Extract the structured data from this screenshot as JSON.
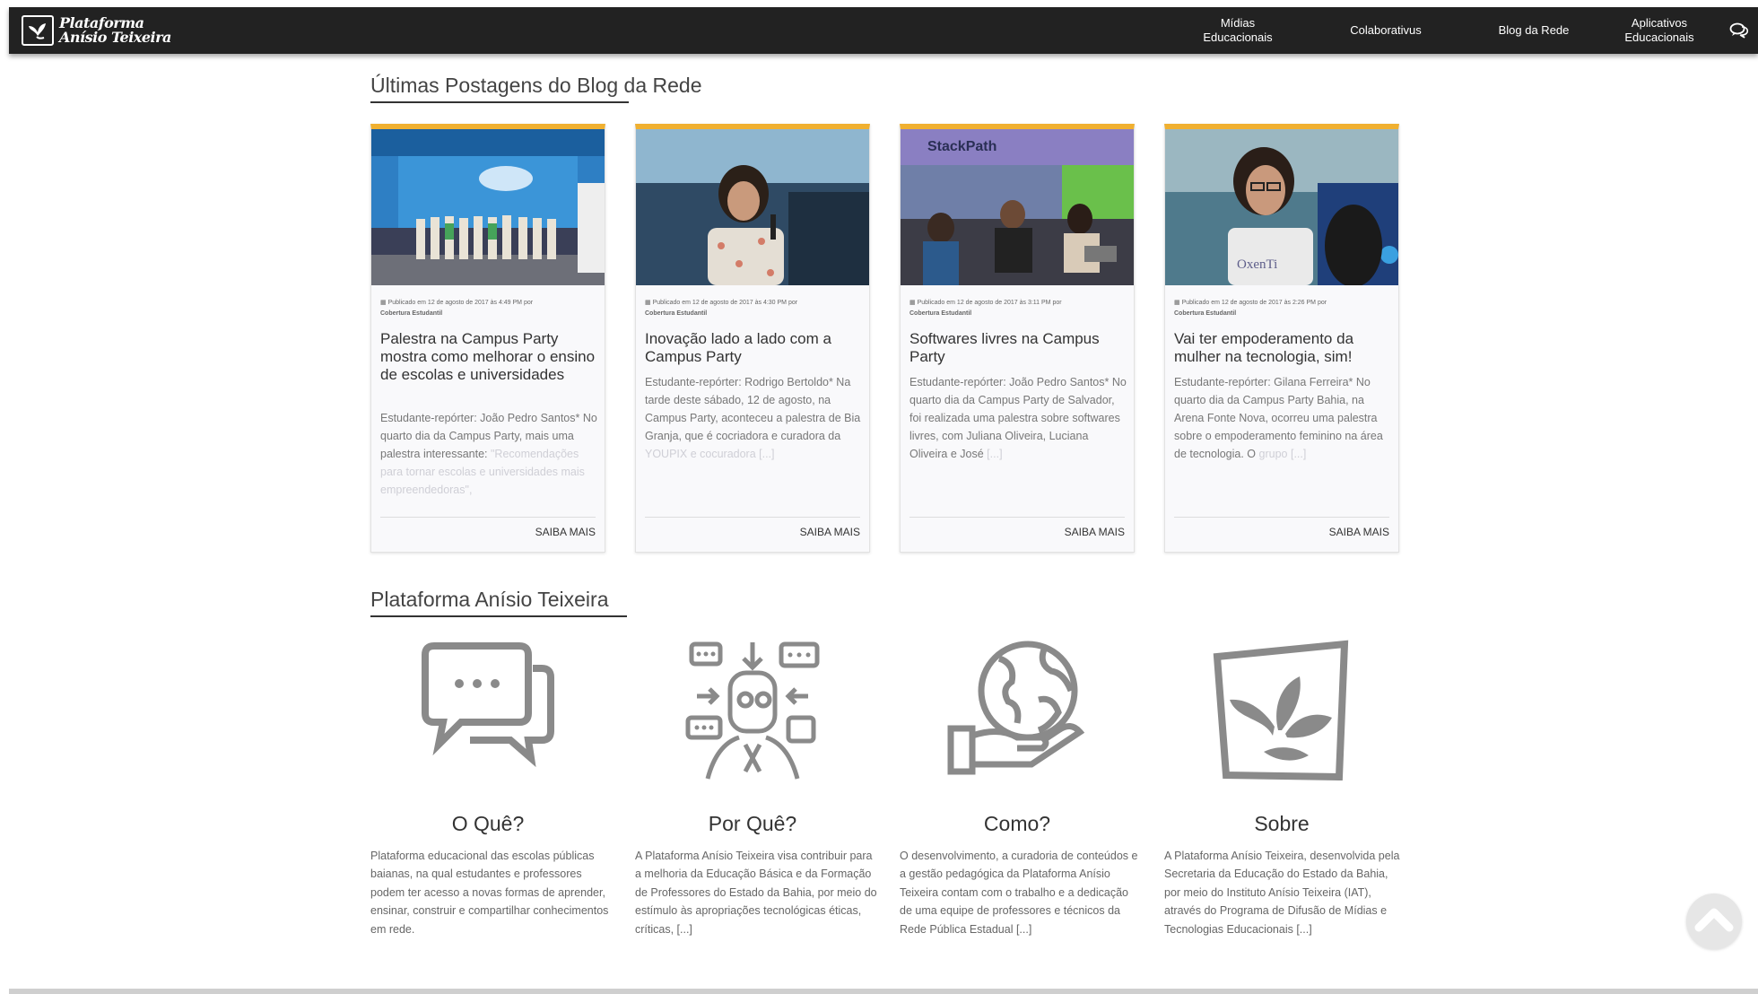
{
  "navbar": {
    "logo_line1": "Plataforma",
    "logo_line2": "Anísio Teixeira",
    "items": [
      {
        "line1": "Mídias",
        "line2": "Educacionais"
      },
      {
        "line1": "Colaborativus",
        "line2": ""
      },
      {
        "line1": "Blog da Rede",
        "line2": ""
      },
      {
        "line1": "Aplicativos",
        "line2": "Educacionais"
      }
    ],
    "chat_icon": "chat-bubbles-icon"
  },
  "blog": {
    "title": "Últimas Postagens do Blog da Rede",
    "posts": [
      {
        "meta": "Publicado em 12 de agosto de 2017 às 4:49 PM por",
        "category": "Cobertura Estudantil",
        "title": "Palestra na Campus Party mostra como melhorar o ensino de escolas e universidades",
        "excerpt": "Estudante-repórter: João Pedro Santos* No quarto dia da Campus Party, mais uma palestra interessante:",
        "excerpt_fade": "\"Recomendações para tornar escolas e universidades mais empreendedoras\",",
        "more": "SAIBA MAIS"
      },
      {
        "meta": "Publicado em 12 de agosto de 2017 às 4:30 PM por",
        "category": "Cobertura Estudantil",
        "title": "Inovação lado a lado com a Campus Party",
        "excerpt": "Estudante-repórter: Rodrigo Bertoldo* Na tarde deste sábado, 12 de agosto, na Campus Party, aconteceu a palestra de Bia Granja, que é cocriadora e curadora da",
        "excerpt_fade": "YOUPIX e cocuradora [...]",
        "more": "SAIBA MAIS"
      },
      {
        "meta": "Publicado em 12 de agosto de 2017 às 3:11 PM por",
        "category": "Cobertura Estudantil",
        "title": "Softwares livres na Campus Party",
        "excerpt": "Estudante-repórter: João Pedro Santos* No quarto dia da Campus Party de Salvador, foi realizada uma palestra sobre softwares livres, com Juliana Oliveira, Luciana Oliveira e José",
        "excerpt_fade": "[...]",
        "more": "SAIBA MAIS"
      },
      {
        "meta": "Publicado em 12 de agosto de 2017 às 2:26 PM por",
        "category": "Cobertura Estudantil",
        "title": "Vai ter empoderamento da mulher na tecnologia, sim!",
        "excerpt": "Estudante-repórter: Gilana Ferreira* No quarto dia da Campus Party Bahia, na Arena Fonte Nova, ocorreu uma palestra sobre o empoderamento feminino na área de tecnologia. O",
        "excerpt_fade": "grupo [...]",
        "more": "SAIBA MAIS"
      }
    ]
  },
  "platform": {
    "title": "Plataforma Anísio Teixeira",
    "features": [
      {
        "icon": "chat-bubbles-icon",
        "heading": "O Quê?",
        "text": "Plataforma educacional das escolas públicas baianas, na qual estudantes e professores podem ter acesso a novas formas de aprender, ensinar, construir e compartilhar conhecimentos em rede."
      },
      {
        "icon": "robot-communication-icon",
        "heading": "Por Quê?",
        "text": "A Plataforma Anísio Teixeira visa contribuir para a melhoria da Educação Básica e da Formação de Professores do Estado da Bahia, por meio do estímulo às apropriações tecnológicas éticas, críticas, [...]"
      },
      {
        "icon": "hand-globe-icon",
        "heading": "Como?",
        "text": "O desenvolvimento, a curadoria de conteúdos e a gestão pedagógica da Plataforma Anísio Teixeira contam com o trabalho e a dedicação de uma equipe de professores e técnicos da Rede Pública Estadual [...]"
      },
      {
        "icon": "plant-logo-icon",
        "heading": "Sobre",
        "text": "A Plataforma Anísio Teixeira, desenvolvida pela Secretaria da Educação do Estado da Bahia, por meio do Instituto Anísio Teixeira (IAT), através do Programa de Difusão de Mídias e Tecnologias Educacionais [...]"
      }
    ]
  },
  "colors": {
    "navbar": "#222222",
    "card_accent": "#f0b030",
    "icon_gray": "#8a8a8a"
  },
  "scroll_top": "chevron-up-icon"
}
